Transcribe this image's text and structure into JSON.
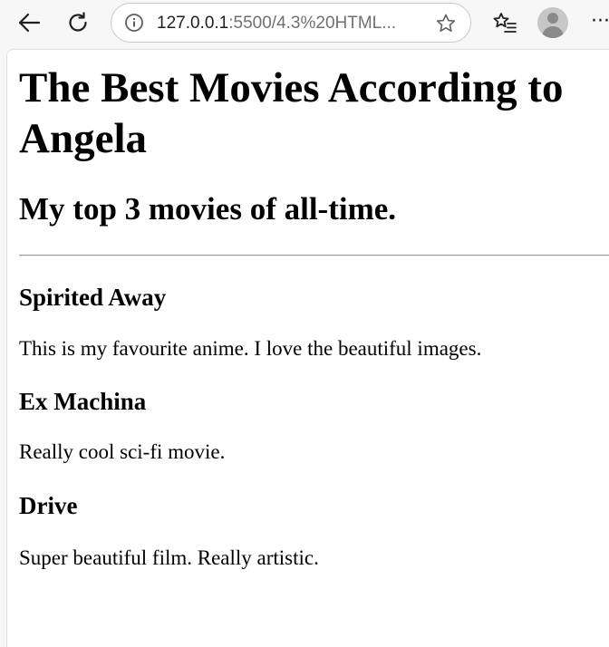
{
  "browser": {
    "url_host": "127.0.0.1",
    "url_rest": ":5500/4.3%20HTML..."
  },
  "page": {
    "title": "The Best Movies According to Angela",
    "subtitle": "My top 3 movies of all-time.",
    "movies": [
      {
        "name": "Spirited Away",
        "description": "This is my favourite anime. I love the beautiful images."
      },
      {
        "name": "Ex Machina",
        "description": "Really cool sci-fi movie."
      },
      {
        "name": "Drive",
        "description": "Super beautiful film. Really artistic."
      }
    ]
  }
}
